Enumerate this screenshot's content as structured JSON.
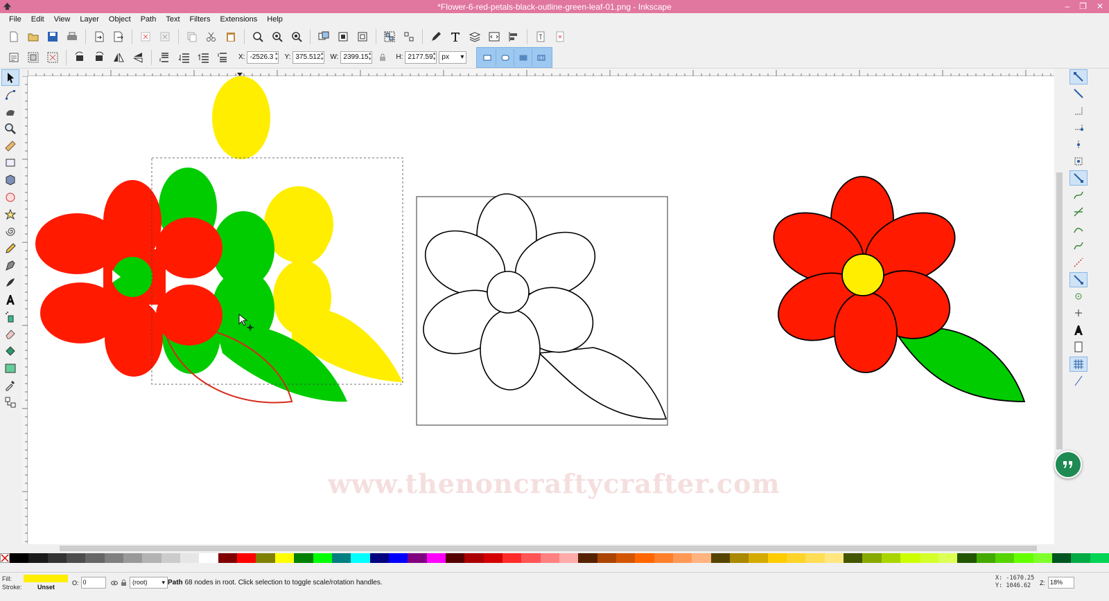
{
  "window": {
    "title": "*Flower-6-red-petals-black-outline-green-leaf-01.png - Inkscape",
    "controls": [
      "–",
      "❐",
      "✕"
    ]
  },
  "menu": [
    "File",
    "Edit",
    "View",
    "Layer",
    "Object",
    "Path",
    "Text",
    "Filters",
    "Extensions",
    "Help"
  ],
  "toolbar": {
    "x_label": "X:",
    "x_value": "-2526.3",
    "y_label": "Y:",
    "y_value": "375.512",
    "w_label": "W:",
    "w_value": "2399.15",
    "h_label": "H:",
    "h_value": "2177.59",
    "unit": "px"
  },
  "canvas": {
    "watermark": "www.thenoncraftycrafter.com",
    "colors": {
      "red": "#ff1a00",
      "green": "#00cc00",
      "yellow": "#ffee00",
      "outline": "#000000",
      "selection_outline": "#d62a1a"
    }
  },
  "status": {
    "fill_label": "Fill:",
    "fill_color": "#ffee00",
    "stroke_label": "Stroke:",
    "stroke_value": "Unset",
    "opacity_label": "O:",
    "opacity_value": "0",
    "layer_value": "(root)",
    "message_bold": "Path",
    "message": "68 nodes in root. Click selection to toggle scale/rotation handles.",
    "x_readout": "X: -1670.25",
    "y_readout": "Y:  1046.62",
    "zoom_label": "Z:",
    "zoom_value": "18%"
  },
  "palette": [
    "#000000",
    "#1a1a1a",
    "#333333",
    "#4d4d4d",
    "#666666",
    "#808080",
    "#999999",
    "#b3b3b3",
    "#cccccc",
    "#e6e6e6",
    "#ffffff",
    "#800000",
    "#ff0000",
    "#808000",
    "#ffff00",
    "#008000",
    "#00ff00",
    "#008080",
    "#00ffff",
    "#000080",
    "#0000ff",
    "#800080",
    "#ff00ff",
    "#550000",
    "#aa0000",
    "#d40000",
    "#ff2a2a",
    "#ff5555",
    "#ff8080",
    "#ffaaaa",
    "#552200",
    "#aa4400",
    "#d45500",
    "#ff6600",
    "#ff7f2a",
    "#ff9955",
    "#ffb380",
    "#554400",
    "#aa8800",
    "#d4aa00",
    "#ffcc00",
    "#ffd42a",
    "#ffdd55",
    "#ffe680",
    "#445500",
    "#88aa00",
    "#aad400",
    "#ccff00",
    "#d4ff2a",
    "#ddff55",
    "#225500",
    "#44aa00",
    "#55d400",
    "#66ff00",
    "#7fff2a",
    "#005522",
    "#00aa44",
    "#00d455"
  ]
}
